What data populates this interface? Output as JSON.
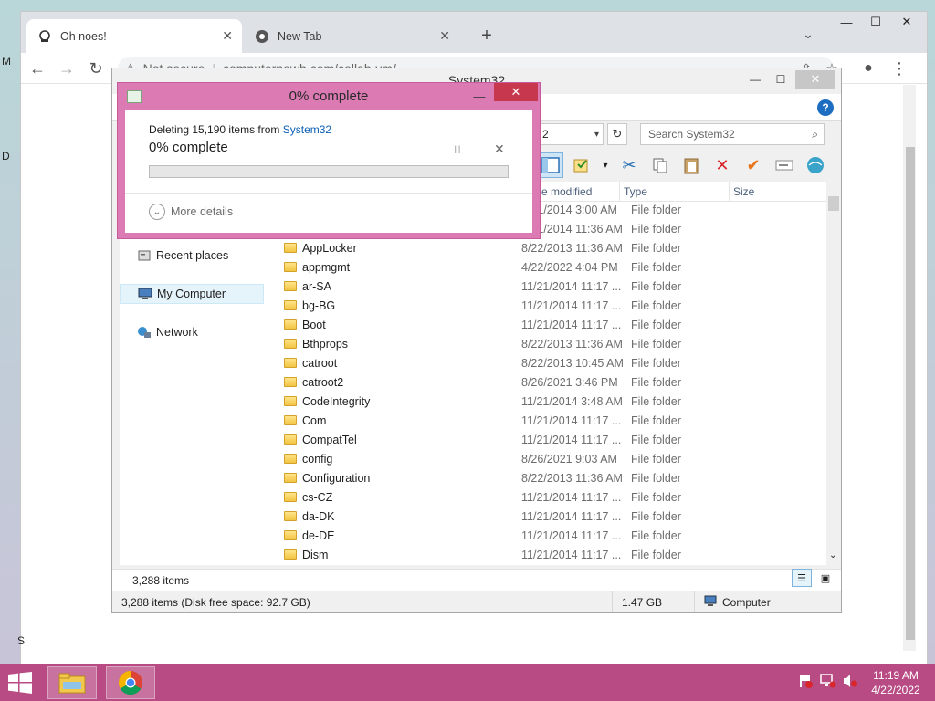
{
  "browser": {
    "tabs": [
      {
        "title": "Oh noes!",
        "icon": "vm-icon",
        "active": true
      },
      {
        "title": "New Tab",
        "icon": "chrome-icon",
        "active": false
      }
    ],
    "new_tab": "+",
    "address": {
      "security_text": "Not secure",
      "url": "computernewb.com/collab-vm/"
    },
    "window_controls": {
      "minimize": "—",
      "maximize": "☐",
      "close": "✕"
    }
  },
  "explorer": {
    "title": "System32",
    "path_value": "2",
    "search_placeholder": "Search System32",
    "columns": {
      "date": "e modified",
      "type": "Type",
      "size": "Size"
    },
    "nav": [
      {
        "label": "Recent places",
        "icon": "recent-places-icon"
      },
      {
        "label": "My Computer",
        "icon": "computer-icon",
        "selected": true
      },
      {
        "label": "Network",
        "icon": "network-icon"
      }
    ],
    "rows": [
      {
        "name": "",
        "date": "1/21/2014 3:00 AM",
        "type": "File folder"
      },
      {
        "name": "",
        "date": "1/21/2014 11:36 AM",
        "type": "File folder"
      },
      {
        "name": "AppLocker",
        "date": "8/22/2013 11:36 AM",
        "type": "File folder"
      },
      {
        "name": "appmgmt",
        "date": "4/22/2022 4:04 PM",
        "type": "File folder"
      },
      {
        "name": "ar-SA",
        "date": "11/21/2014 11:17 ...",
        "type": "File folder"
      },
      {
        "name": "bg-BG",
        "date": "11/21/2014 11:17 ...",
        "type": "File folder"
      },
      {
        "name": "Boot",
        "date": "11/21/2014 11:17 ...",
        "type": "File folder"
      },
      {
        "name": "Bthprops",
        "date": "8/22/2013 11:36 AM",
        "type": "File folder"
      },
      {
        "name": "catroot",
        "date": "8/22/2013 10:45 AM",
        "type": "File folder"
      },
      {
        "name": "catroot2",
        "date": "8/26/2021 3:46 PM",
        "type": "File folder"
      },
      {
        "name": "CodeIntegrity",
        "date": "11/21/2014 3:48 AM",
        "type": "File folder"
      },
      {
        "name": "Com",
        "date": "11/21/2014 11:17 ...",
        "type": "File folder"
      },
      {
        "name": "CompatTel",
        "date": "11/21/2014 11:17 ...",
        "type": "File folder"
      },
      {
        "name": "config",
        "date": "8/26/2021 9:03 AM",
        "type": "File folder"
      },
      {
        "name": "Configuration",
        "date": "8/22/2013 11:36 AM",
        "type": "File folder"
      },
      {
        "name": "cs-CZ",
        "date": "11/21/2014 11:17 ...",
        "type": "File folder"
      },
      {
        "name": "da-DK",
        "date": "11/21/2014 11:17 ...",
        "type": "File folder"
      },
      {
        "name": "de-DE",
        "date": "11/21/2014 11:17 ...",
        "type": "File folder"
      },
      {
        "name": "Dism",
        "date": "11/21/2014 11:17 ...",
        "type": "File folder"
      }
    ],
    "item_count": "3,288 items",
    "status": {
      "summary": "3,288 items (Disk free space: 92.7 GB)",
      "size": "1.47 GB",
      "location": "Computer"
    }
  },
  "dialog": {
    "title": "0% complete",
    "deleting_prefix": "Deleting 15,190 items from",
    "source": "System32",
    "progress_text": "0% complete",
    "progress": 0,
    "more_details": "More details",
    "pause_glyph": "II",
    "cancel_glyph": "✕"
  },
  "taskbar": {
    "time": "11:19 AM",
    "date": "4/22/2022"
  },
  "edge_fragments": {
    "left_top": "M",
    "left_mid": "D",
    "left_bottom": "S"
  },
  "colors": {
    "dialog_frame": "#db7ab3",
    "taskbar": "#b84b84",
    "close_red": "#c7384f",
    "link_blue": "#0b5fb4"
  }
}
